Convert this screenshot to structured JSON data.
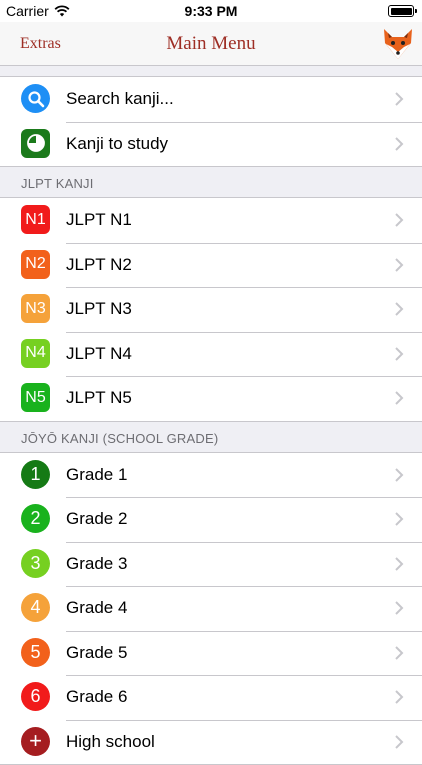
{
  "status_bar": {
    "carrier": "Carrier",
    "time": "9:33 PM"
  },
  "nav": {
    "left_label": "Extras",
    "title": "Main Menu"
  },
  "top_items": [
    {
      "label": "Search kanji...",
      "icon": "magnifier-icon",
      "color": "#1e8ff5"
    },
    {
      "label": "Kanji to study",
      "icon": "progress-icon",
      "color": "#1b7a1b"
    }
  ],
  "sections": [
    {
      "header": "JLPT KANJI",
      "items": [
        {
          "badge": "N1",
          "label": "JLPT N1",
          "color": "#f11b1b"
        },
        {
          "badge": "N2",
          "label": "JLPT N2",
          "color": "#f2611b"
        },
        {
          "badge": "N3",
          "label": "JLPT N3",
          "color": "#f5a23a"
        },
        {
          "badge": "N4",
          "label": "JLPT N4",
          "color": "#76d021"
        },
        {
          "badge": "N5",
          "label": "JLPT N5",
          "color": "#19b21d"
        }
      ]
    },
    {
      "header": "JŌYŌ KANJI (SCHOOL GRADE)",
      "items": [
        {
          "badge": "1",
          "label": "Grade 1",
          "color": "#157a15"
        },
        {
          "badge": "2",
          "label": "Grade 2",
          "color": "#19b21d"
        },
        {
          "badge": "3",
          "label": "Grade 3",
          "color": "#76d021"
        },
        {
          "badge": "4",
          "label": "Grade 4",
          "color": "#f5a23a"
        },
        {
          "badge": "5",
          "label": "Grade 5",
          "color": "#f2611b"
        },
        {
          "badge": "6",
          "label": "Grade 6",
          "color": "#f11b1b"
        },
        {
          "badge": "+",
          "label": "High school",
          "color": "#a51d20"
        }
      ]
    }
  ]
}
